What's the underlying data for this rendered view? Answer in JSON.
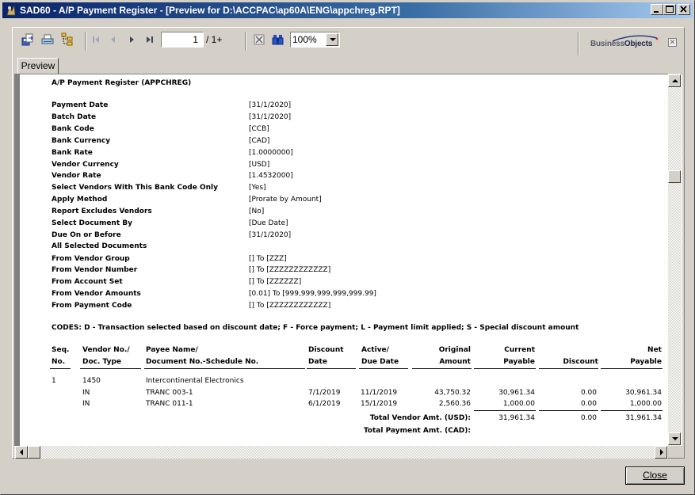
{
  "window": {
    "title": "SAD60  - A/P Payment Register - [Preview for D:\\ACCPAC\\ap60A\\ENG\\appchreg.RPT]",
    "controls": [
      "minimize",
      "maximize",
      "close"
    ]
  },
  "toolbar": {
    "icons": [
      "export-icon",
      "print-icon",
      "group-tree-icon",
      "first-page-icon",
      "previous-page-icon",
      "next-page-icon",
      "last-page-icon",
      "stop-icon",
      "search-icon"
    ],
    "page_number": "1",
    "page_total": "/ 1+",
    "zoom": "100%",
    "brand_light": "Business",
    "brand_dark": "Objects"
  },
  "tabs": [
    {
      "label": "Preview",
      "active": true
    }
  ],
  "report": {
    "title": "A/P Payment Register  (APPCHREG)",
    "params": [
      {
        "label": "Payment Date",
        "value": "[31/1/2020]"
      },
      {
        "label": "Batch Date",
        "value": "[31/1/2020]"
      },
      {
        "label": "Bank Code",
        "value": "[CCB]"
      },
      {
        "label": "Bank Currency",
        "value": "[CAD]"
      },
      {
        "label": "Bank Rate",
        "value": "[1.0000000]"
      },
      {
        "label": "Vendor Currency",
        "value": "[USD]"
      },
      {
        "label": "Vendor Rate",
        "value": "[1.4532000]"
      },
      {
        "label": "Select Vendors With This Bank Code Only",
        "value": "[Yes]"
      },
      {
        "label": "Apply Method",
        "value": "[Prorate by Amount]"
      },
      {
        "label": "Report Excludes Vendors",
        "value": "[No]"
      },
      {
        "label": "Select Document By",
        "value": "[Due Date]"
      },
      {
        "label": "Due On or Before",
        "value": "[31/1/2020]"
      },
      {
        "label": "All Selected Documents",
        "value": ""
      },
      {
        "label": "From Vendor Group",
        "value": "[]  To  [ZZZ]"
      },
      {
        "label": "From Vendor Number",
        "value": "[]  To  [ZZZZZZZZZZZZ]"
      },
      {
        "label": "From Account Set",
        "value": "[]  To  [ZZZZZZ]"
      },
      {
        "label": "From Vendor Amounts",
        "value": "[0.01]  To  [999,999,999,999,999.99]"
      },
      {
        "label": "From Payment Code",
        "value": "[]  To  [ZZZZZZZZZZZZ]"
      }
    ],
    "codes": "CODES:  D - Transaction selected based on discount date;    F - Force payment;    L - Payment limit applied;    S - Special discount amount",
    "columns": [
      {
        "line1": "Seq.",
        "line2": "No."
      },
      {
        "line1": "Vendor No./",
        "line2": "Doc. Type"
      },
      {
        "line1": "Payee Name/",
        "line2": "Document No.-Schedule No."
      },
      {
        "line1": "Discount",
        "line2": "Date"
      },
      {
        "line1": "Active/",
        "line2": "Due Date"
      },
      {
        "line1": "Original",
        "line2": "Amount"
      },
      {
        "line1": "Current",
        "line2": "Payable"
      },
      {
        "line1": "",
        "line2": "Discount"
      },
      {
        "line1": "Net",
        "line2": "Payable"
      }
    ],
    "vendor": {
      "seq": "1",
      "vendor_no": "1450",
      "payee": "Intercontinental Electronics"
    },
    "rows": [
      {
        "doc_type": "IN",
        "doc_no": "TRANC 003-1",
        "discount_date": "7/1/2019",
        "due_date": "11/1/2019",
        "original": "43,750.32",
        "current": "30,961.34",
        "discount": "0.00",
        "net": "30,961.34"
      },
      {
        "doc_type": "IN",
        "doc_no": "TRANC 011-1",
        "discount_date": "6/1/2019",
        "due_date": "15/1/2019",
        "original": "2,560.36",
        "current": "1,000.00",
        "discount": "0.00",
        "net": "1,000.00"
      }
    ],
    "totals": {
      "vendor_label": "Total Vendor Amt. (USD):",
      "vendor_current": "31,961.34",
      "vendor_discount": "0.00",
      "vendor_net": "31,961.34",
      "payment_label": "Total Payment Amt. (CAD):"
    }
  },
  "footer": {
    "close_label": "Close"
  }
}
